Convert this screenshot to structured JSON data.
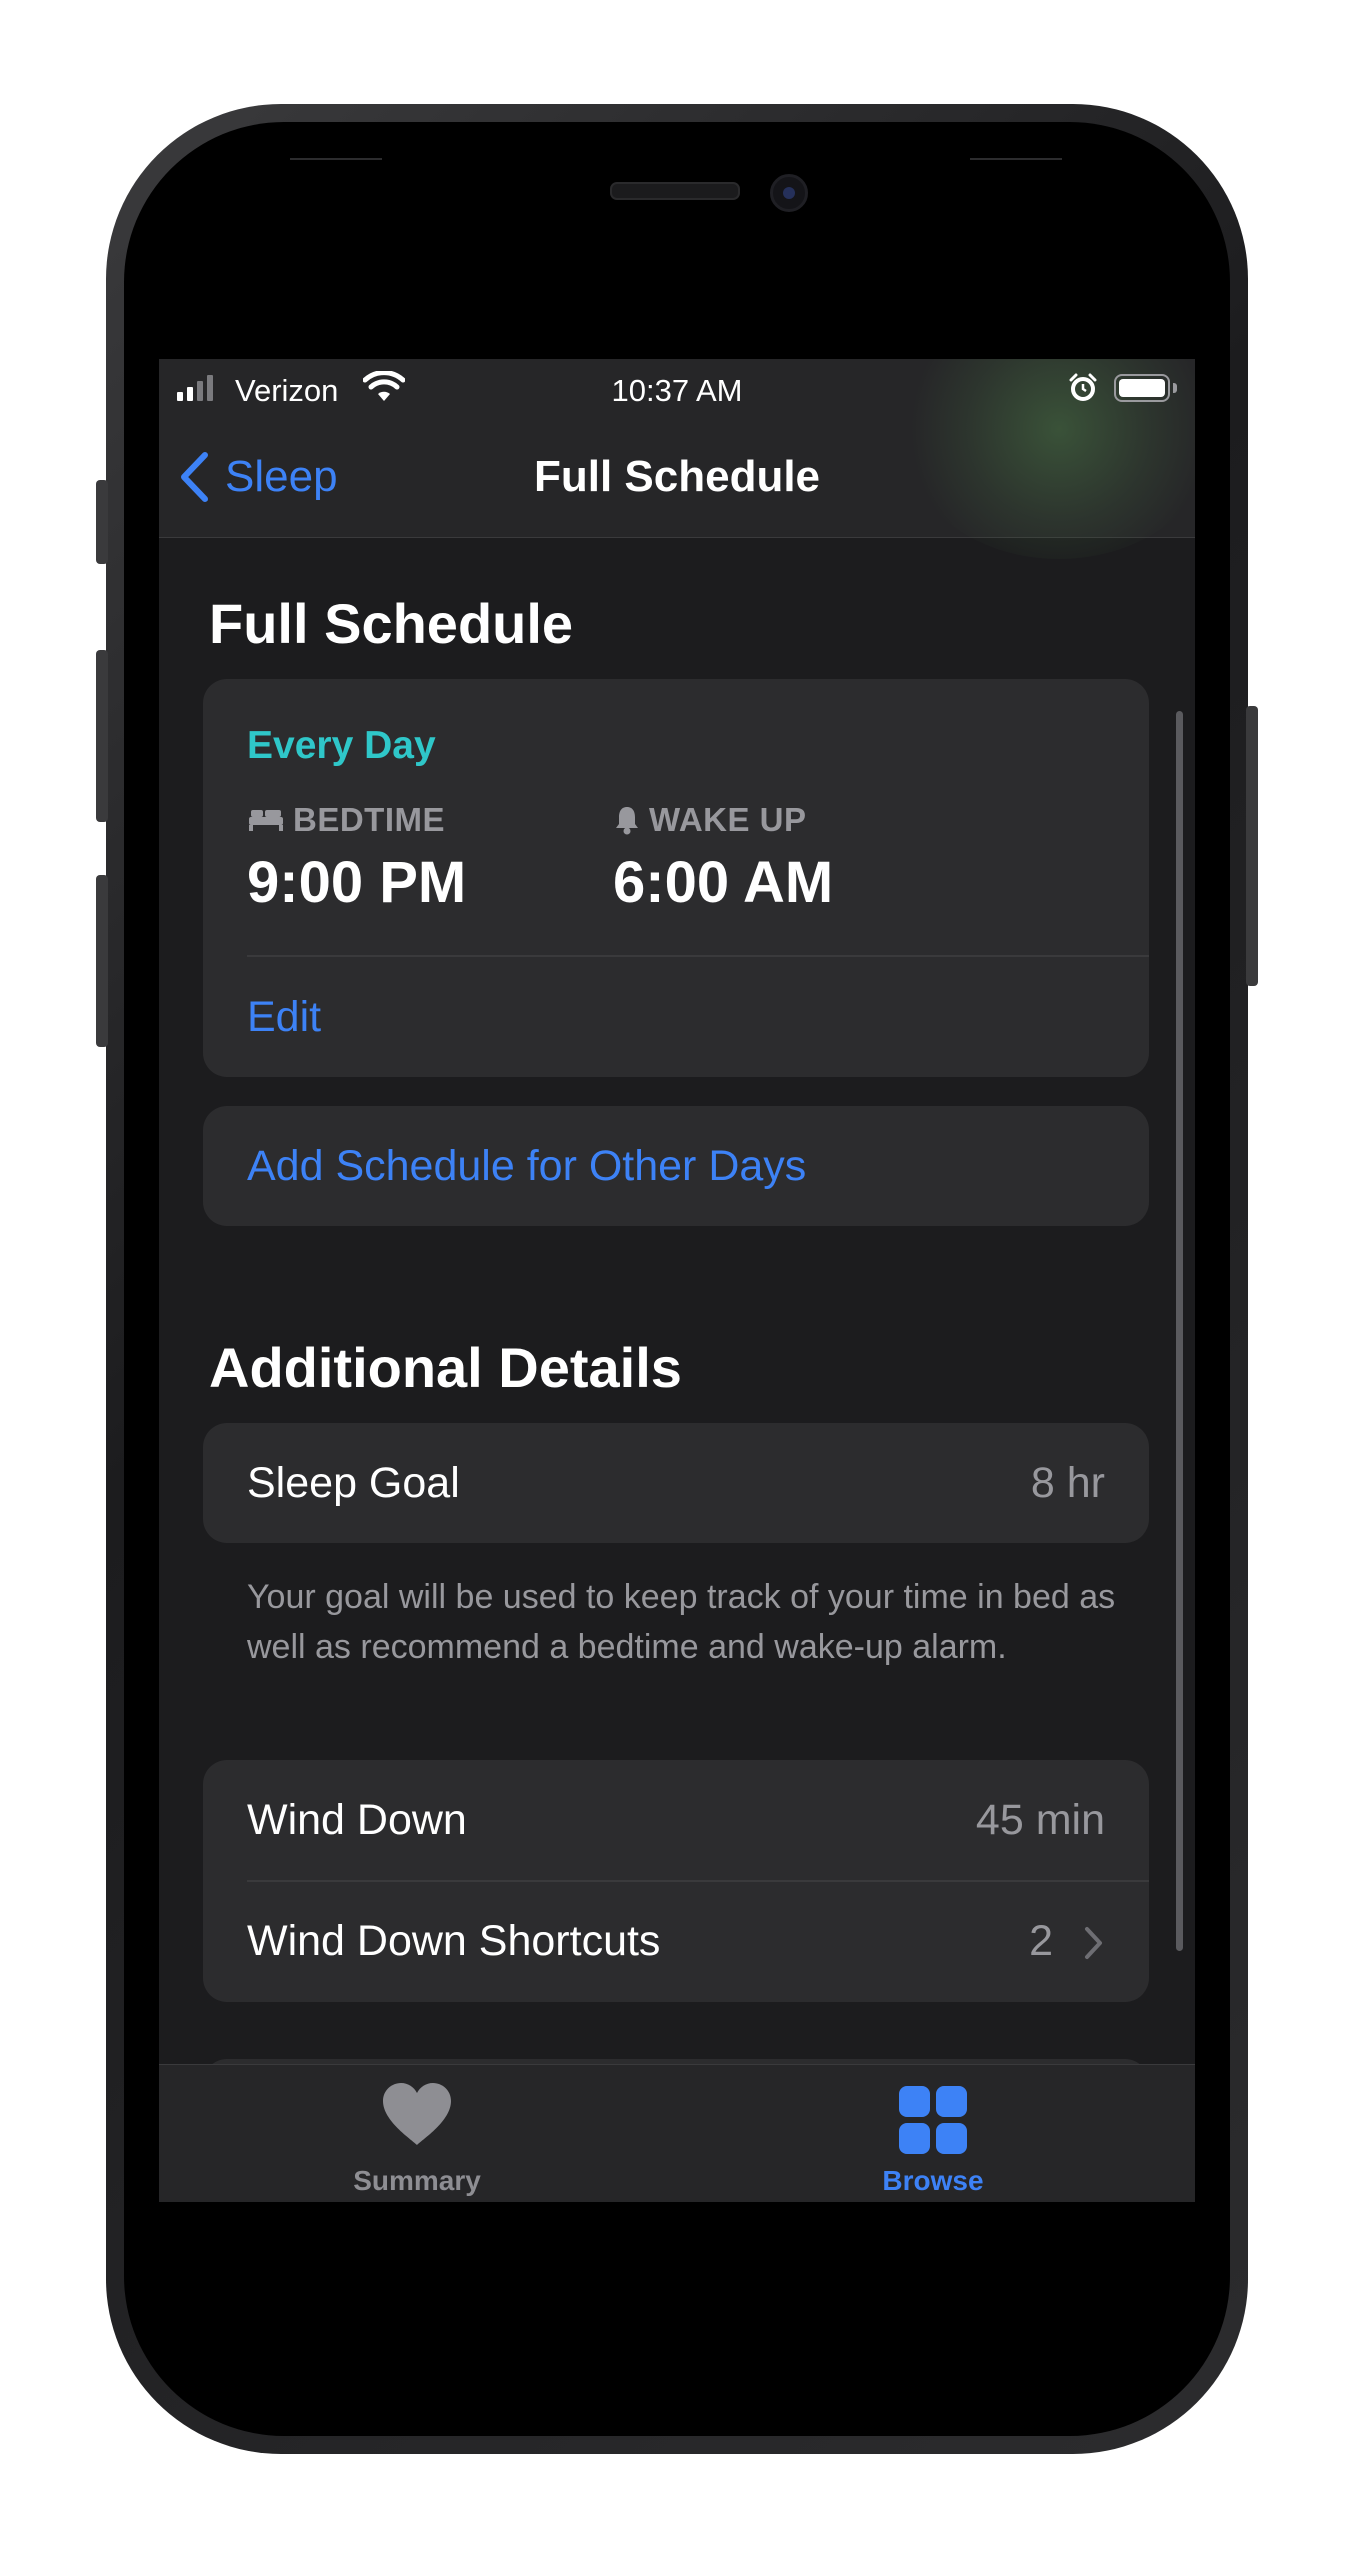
{
  "status_bar": {
    "carrier": "Verizon",
    "time": "10:37 AM"
  },
  "nav": {
    "back_label": "Sleep",
    "title": "Full Schedule"
  },
  "full_schedule": {
    "section_title": "Full Schedule",
    "days_label": "Every Day",
    "bedtime_label": "BEDTIME",
    "bedtime_value": "9:00 PM",
    "wake_label": "WAKE UP",
    "wake_value": "6:00 AM",
    "edit_label": "Edit",
    "add_schedule_label": "Add Schedule for Other Days"
  },
  "additional_details": {
    "section_title": "Additional Details",
    "sleep_goal_label": "Sleep Goal",
    "sleep_goal_value": "8 hr",
    "footnote": "Your goal will be used to keep track of your time in bed as well as recommend a bedtime and wake-up alarm.",
    "wind_down_label": "Wind Down",
    "wind_down_value": "45 min",
    "wind_down_shortcuts_label": "Wind Down Shortcuts",
    "wind_down_shortcuts_value": "2"
  },
  "tab_bar": {
    "tabs": [
      {
        "label": "Summary",
        "icon": "heart-icon",
        "active": false
      },
      {
        "label": "Browse",
        "icon": "grid-icon",
        "active": true
      }
    ]
  },
  "colors": {
    "accent_blue": "#3d82f6",
    "teal": "#2fc7c9",
    "background": "#1c1c1e",
    "card": "#2c2c2e"
  }
}
